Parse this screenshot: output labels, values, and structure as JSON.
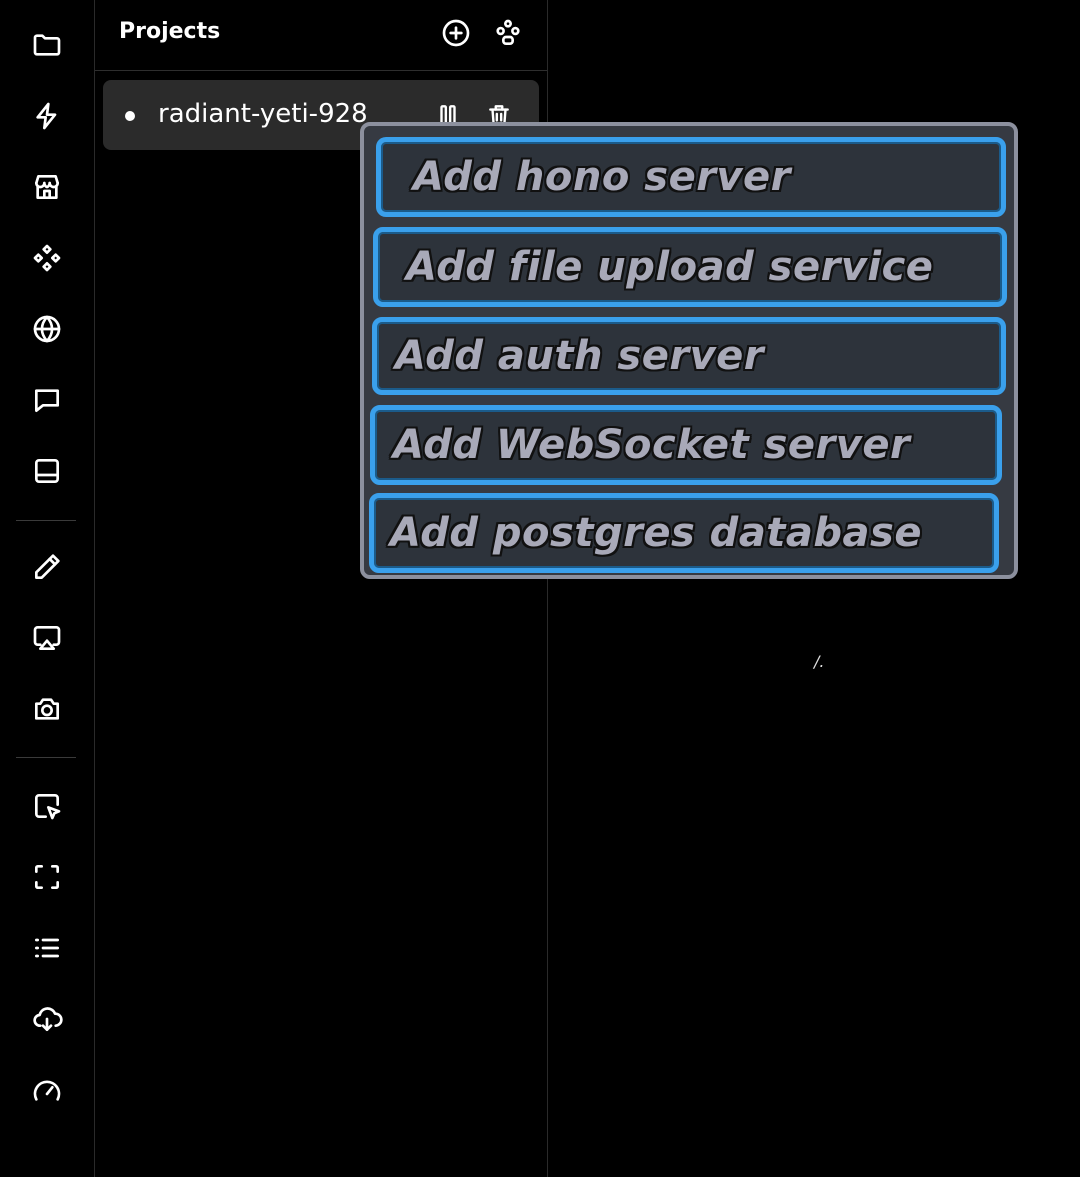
{
  "sidebar": {
    "icons": [
      "folder-icon",
      "bolt-icon",
      "store-icon",
      "components-icon",
      "globe-icon",
      "message-icon",
      "panel-bottom-icon",
      "pencil-icon",
      "airplay-icon",
      "camera-icon",
      "pointer-select-icon",
      "scan-icon",
      "list-icon",
      "cloud-download-icon",
      "gauge-icon"
    ]
  },
  "projects": {
    "title": "Projects",
    "header_icons": [
      "add-circle-icon",
      "nodes-icon"
    ],
    "items": [
      {
        "name": "radiant-yeti-928",
        "status_color": "#ffffff"
      }
    ]
  },
  "menu": {
    "items": [
      {
        "label": "Add hono server"
      },
      {
        "label": "Add file upload service"
      },
      {
        "label": "Add auth server"
      },
      {
        "label": "Add WebSocket server"
      },
      {
        "label": "Add postgres database"
      }
    ]
  },
  "canvas": {
    "mark": "/."
  },
  "colors": {
    "background": "#000000",
    "panel_border": "#2a2a2a",
    "row_bg": "#2b2b2b",
    "popover_bg": "#363a42",
    "popover_border": "#8c909e",
    "item_border": "#3aa0ec",
    "item_bg": "#2d333b",
    "item_text": "#a8a9b8"
  }
}
